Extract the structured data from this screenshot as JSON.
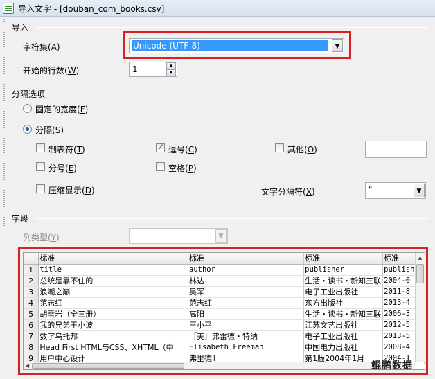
{
  "window": {
    "title": "导入文字 - [douban_com_books.csv]"
  },
  "import": {
    "section_label": "导入",
    "charset_label": "字符集",
    "charset_key": "A",
    "charset_value": "Unicode (UTF-8)",
    "start_row_label": "开始的行数",
    "start_row_key": "W",
    "start_row_value": "1"
  },
  "separator": {
    "section_label": "分隔选项",
    "fixed_width_label": "固定的宽度",
    "fixed_width_key": "F",
    "separated_label": "分隔",
    "separated_key": "S",
    "tab_label": "制表符",
    "tab_key": "T",
    "comma_label": "逗号",
    "comma_key": "C",
    "other_label": "其他",
    "other_key": "O",
    "other_value": "",
    "semicolon_label": "分号",
    "semicolon_key": "E",
    "space_label": "空格",
    "space_key": "P",
    "merge_label": "压缩显示",
    "merge_key": "D",
    "text_delimiter_label": "文字分隔符",
    "text_delimiter_key": "X",
    "text_delimiter_value": "\""
  },
  "fields": {
    "section_label": "字段",
    "column_type_label": "列类型",
    "column_type_key": "Y",
    "column_type_value": "",
    "headers": [
      "标准",
      "标准",
      "标准",
      "标准"
    ],
    "rows": [
      {
        "n": "1",
        "c": [
          "title",
          "author",
          "publisher",
          "publish"
        ]
      },
      {
        "n": "2",
        "c": [
          "总统是靠不住的",
          "林达",
          "生活・读书・新知三联",
          "2004-0"
        ]
      },
      {
        "n": "3",
        "c": [
          "浪潮之巅",
          "吴军",
          "电子工业出版社",
          "2011-8"
        ]
      },
      {
        "n": "4",
        "c": [
          "范志红",
          "范志红",
          "东方出版社",
          "2013-4"
        ]
      },
      {
        "n": "5",
        "c": [
          "胡雪岩（全三册）",
          "高阳",
          "生活・读书・新知三联",
          "2006-3"
        ]
      },
      {
        "n": "6",
        "c": [
          "我的兄弟王小波",
          "王小平",
          "江苏文艺出版社",
          "2012-5"
        ]
      },
      {
        "n": "7",
        "c": [
          "数字乌托邦",
          "［美］弗雷德・特纳",
          "电子工业出版社",
          "2013-5"
        ]
      },
      {
        "n": "8",
        "c": [
          "Head First HTML与CSS、XHTML（中",
          "Elisabeth Freeman",
          "中国电力出版社",
          "2008-4"
        ]
      },
      {
        "n": "9",
        "c": [
          "用户中心设计",
          "弗里德Ⅱ",
          "第1版2004年1月",
          "2004-1"
        ]
      }
    ]
  },
  "watermark": "鲲鹏数据",
  "colors": {
    "highlight": "#3399ff",
    "annotation_red": "#d62222"
  }
}
